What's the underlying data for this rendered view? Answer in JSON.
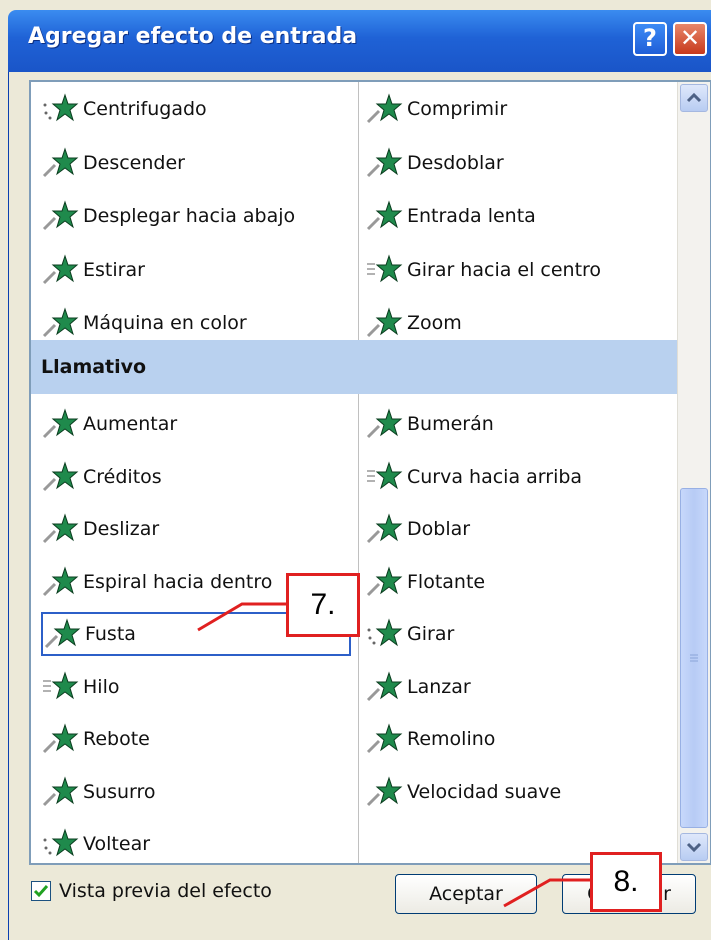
{
  "dialog": {
    "title": "Agregar efecto de entrada",
    "help_glyph": "?",
    "close_glyph": "✕"
  },
  "list": {
    "group1_left": [
      "Centrifugado",
      "Descender",
      "Desplegar hacia abajo",
      "Estirar",
      "Máquina en color"
    ],
    "group1_right": [
      "Comprimir",
      "Desdoblar",
      "Entrada lenta",
      "Girar hacia el centro",
      "Zoom"
    ],
    "category": "Llamativo",
    "group2_left": [
      "Aumentar",
      "Créditos",
      "Deslizar",
      "Espiral hacia dentro",
      "Fusta",
      "Hilo",
      "Rebote",
      "Susurro",
      "Voltear"
    ],
    "group2_right": [
      "Bumerán",
      "Curva hacia arriba",
      "Doblar",
      "Flotante",
      "Girar",
      "Lanzar",
      "Remolino",
      "Velocidad suave"
    ],
    "selected": "Fusta"
  },
  "footer": {
    "preview_label": "Vista previa del efecto",
    "preview_checked": true,
    "ok_label": "Aceptar",
    "cancel_label": "Cancelar"
  },
  "annotations": {
    "step7": "7.",
    "step8": "8."
  },
  "colors": {
    "accent": "#1f62d6",
    "category_bg": "#b9d1ef",
    "callout": "#e02020",
    "star": "#1f8a4c"
  }
}
